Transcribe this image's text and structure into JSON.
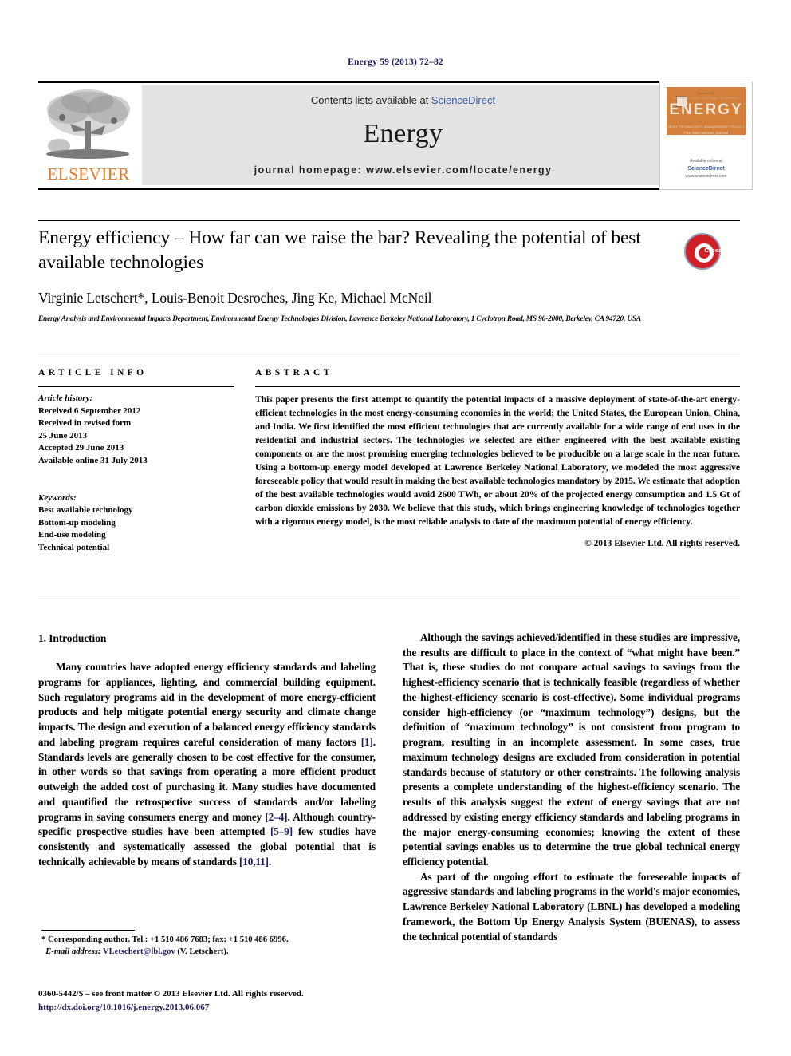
{
  "running_head": "Energy 59 (2013) 72–82",
  "masthead": {
    "contents_prefix": "Contents lists available at ",
    "sciencedirect": "ScienceDirect",
    "journal_name": "Energy",
    "homepage": "journal homepage: www.elsevier.com/locate/energy",
    "publisher_logo_text": "ELSEVIER",
    "publisher_logo_icon": "elsevier-tree-icon",
    "cover": {
      "title": "ENERGY",
      "top_left_label": "ISSN",
      "top_right_label": "Volume 59",
      "band_top": "INTERNATIONAL  JOURNAL  OF  ENERGY",
      "band_bottom": "HEAT   TECHNOLOGY   MANAGEMENT   POLICY",
      "tagline": "The international journal",
      "bottom_line_1": "Available online at",
      "bottom_line_2": "ScienceDirect",
      "bottom_line_3": "www.sciencedirect.com"
    }
  },
  "crossmark": {
    "label": "CrossMark",
    "icon": "crossmark-badge-icon"
  },
  "article": {
    "title": "Energy efficiency – How far can we raise the bar? Revealing the potential of best available technologies",
    "authors": "Virginie Letschert*, Louis-Benoit Desroches, Jing Ke, Michael McNeil",
    "affiliation": "Energy Analysis and Environmental Impacts Department, Environmental Energy Technologies Division, Lawrence Berkeley National Laboratory, 1 Cyclotron Road, MS 90-2000, Berkeley, CA 94720, USA"
  },
  "article_info": {
    "heading": "ARTICLE INFO",
    "history_label": "Article history:",
    "history_lines": [
      "Received 6 September 2012",
      "Received in revised form",
      "25 June 2013",
      "Accepted 29 June 2013",
      "Available online 31 July 2013"
    ],
    "keywords_label": "Keywords:",
    "keywords": [
      "Best available technology",
      "Bottom-up modeling",
      "End-use modeling",
      "Technical potential"
    ]
  },
  "abstract": {
    "heading": "ABSTRACT",
    "text": "This paper presents the first attempt to quantify the potential impacts of a massive deployment of state-of-the-art energy-efficient technologies in the most energy-consuming economies in the world; the United States, the European Union, China, and India. We first identified the most efficient technologies that are currently available for a wide range of end uses in the residential and industrial sectors. The technologies we selected are either engineered with the best available existing components or are the most promising emerging technologies believed to be producible on a large scale in the near future. Using a bottom-up energy model developed at Lawrence Berkeley National Laboratory, we modeled the most aggressive foreseeable policy that would result in making the best available technologies mandatory by 2015. We estimate that adoption of the best available technologies would avoid 2600 TWh, or about 20% of the projected energy consumption and 1.5 Gt of carbon dioxide emissions by 2030. We believe that this study, which brings engineering knowledge of technologies together with a rigorous energy model, is the most reliable analysis to date of the maximum potential of energy efficiency.",
    "copyright": "© 2013 Elsevier Ltd. All rights reserved."
  },
  "body": {
    "section_heading": "1. Introduction",
    "left_paragraph_1_a": "Many countries have adopted energy efficiency standards and labeling programs for appliances, lighting, and commercial building equipment. Such regulatory programs aid in the development of more energy-efficient products and help mitigate potential energy security and climate change impacts. The design and execution of a balanced energy efficiency standards and labeling program requires careful consideration of many factors ",
    "ref_1": "[1]",
    "left_paragraph_1_b": ". Standards levels are generally chosen to be cost effective for the consumer, in other words so that savings from operating a more efficient product outweigh the added cost of purchasing it. Many studies have documented and quantified the retrospective success of standards and/or labeling programs in saving consumers energy and money ",
    "ref_2_4": "[2–4]",
    "left_paragraph_1_c": ". Although country-specific prospective studies have been attempted ",
    "ref_5_9": "[5–9]",
    "left_paragraph_1_d": " few studies have consistently and systematically assessed the global potential that is technically achievable by means of standards ",
    "ref_10_11": "[10,11]",
    "left_paragraph_1_e": ".",
    "right_paragraph_1": "Although the savings achieved/identified in these studies are impressive, the results are difficult to place in the context of “what might have been.” That is, these studies do not compare actual savings to savings from the highest-efficiency scenario that is technically feasible (regardless of whether the highest-efficiency scenario is cost-effective). Some individual programs consider high-efficiency (or “maximum technology”) designs, but the definition of “maximum technology” is not consistent from program to program, resulting in an incomplete assessment. In some cases, true maximum technology designs are excluded from consideration in potential standards because of statutory or other constraints. The following analysis presents a complete understanding of the highest-efficiency scenario. The results of this analysis suggest the extent of energy savings that are not addressed by existing energy efficiency standards and labeling programs in the major energy-consuming economies; knowing the extent of these potential savings enables us to determine the true global technical energy efficiency potential.",
    "right_paragraph_2": "As part of the ongoing effort to estimate the foreseeable impacts of aggressive standards and labeling programs in the world's major economies, Lawrence Berkeley National Laboratory (LBNL) has developed a modeling framework, the Bottom Up Energy Analysis System (BUENAS), to assess the technical potential of standards"
  },
  "footnotes": {
    "corresponding": "* Corresponding author. Tel.: +1 510 486 7683; fax: +1 510 486 6996.",
    "email_label": "E-mail address:",
    "email": "VLetschert@lbl.gov",
    "email_suffix": " (V. Letschert).",
    "imprint": "0360-5442/$ – see front matter © 2013 Elsevier Ltd. All rights reserved.",
    "doi": "http://dx.doi.org/10.1016/j.energy.2013.06.067"
  },
  "colors": {
    "link_blue": "#3b5ba9",
    "ref_navy": "#1b1a5e",
    "elsevier_orange": "#e87722",
    "crossmark_red": "#cf2027",
    "mast_gray": "#e3e3e3"
  }
}
